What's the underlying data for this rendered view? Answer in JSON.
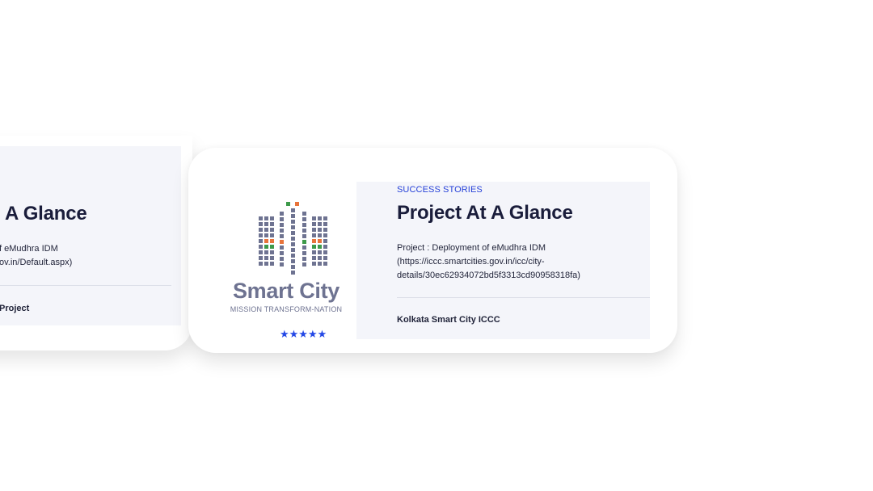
{
  "previous_card": {
    "title": "A Glance",
    "description_lines": [
      "f eMudhra IDM",
      "ov.in/Default.aspx)"
    ],
    "footer": "Project"
  },
  "main_card": {
    "logo": {
      "name_text": "Smart City",
      "tagline": "MISSION TRANSFORM-NATION",
      "stars": "★★★★★",
      "colors": {
        "grey": "#6e7391",
        "orange": "#e8743b",
        "green": "#3d9a4a",
        "star_blue": "#2448e6"
      }
    },
    "eyebrow": "SUCCESS STORIES",
    "title": "Project At A Glance",
    "description_lines": [
      "Project : Deployment of eMudhra IDM",
      "(https://iccc.smartcities.gov.in/icc/city-",
      "details/30ec62934072bd5f3313cd90958318fa)"
    ],
    "footer": "Kolkata Smart City ICCC"
  },
  "colors": {
    "accent_blue": "#2540d8",
    "title": "#1a1d3b",
    "panel_bg": "#f4f5fa"
  }
}
